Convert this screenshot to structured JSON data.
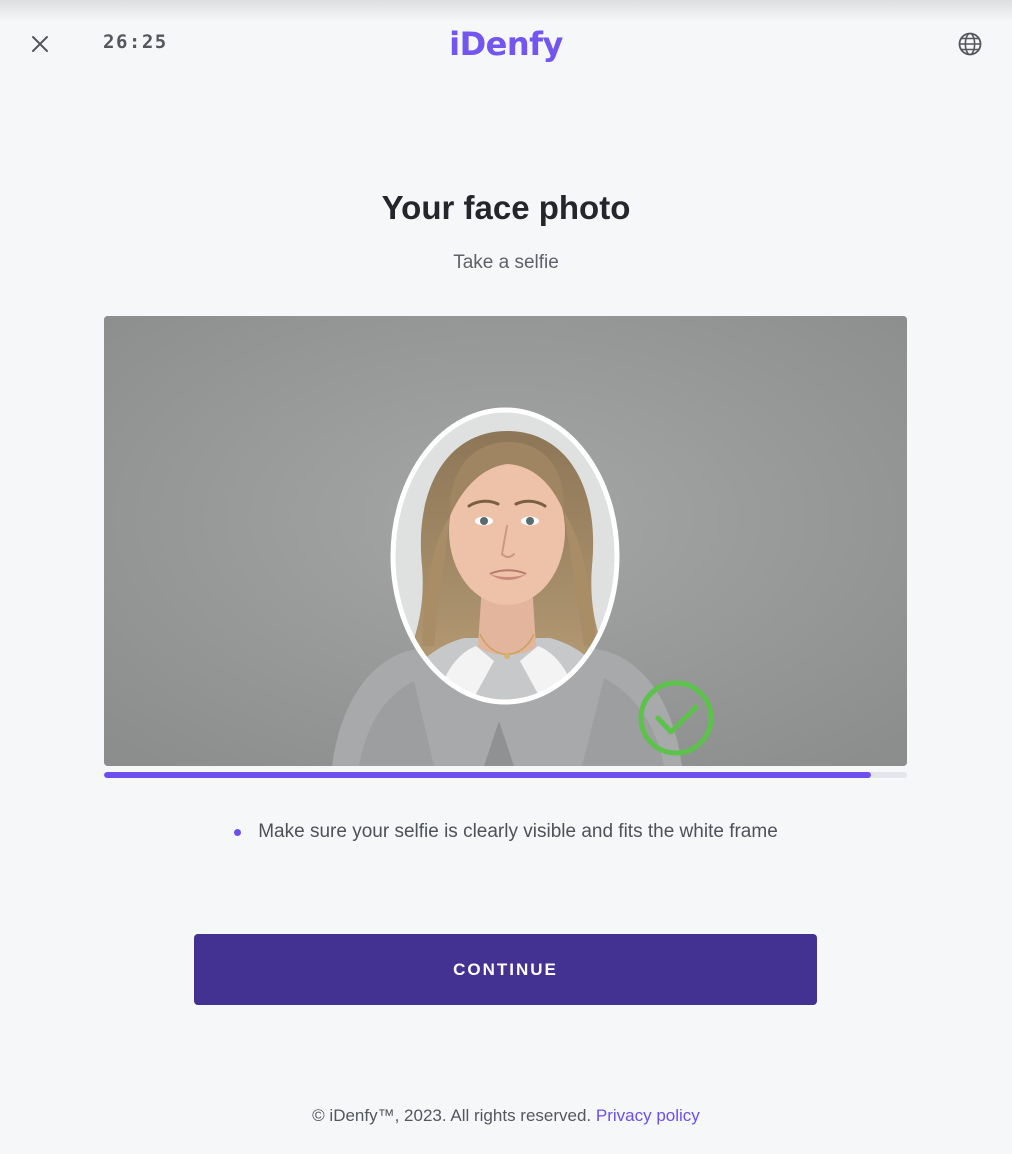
{
  "header": {
    "timer": "26:25",
    "logo_text": "iDenfy",
    "close_icon": "close-icon",
    "language_icon": "globe-icon"
  },
  "main": {
    "title": "Your face photo",
    "subtitle": "Take a selfie",
    "photo": {
      "description": "selfie-preview",
      "overlay_icon": "check-circle-icon"
    },
    "progress": {
      "fraction": 0.955
    },
    "instructions": [
      "Make sure your selfie is clearly visible and fits the white frame"
    ],
    "continue_label": "CONTINUE"
  },
  "footer": {
    "copyright": "© iDenfy™, 2023. All rights reserved.",
    "privacy_link": "Privacy policy"
  },
  "colors": {
    "brand_purple": "#6d4ff0",
    "button_purple": "#433291",
    "success_green": "#58c24a",
    "background": "#f6f7f9"
  }
}
